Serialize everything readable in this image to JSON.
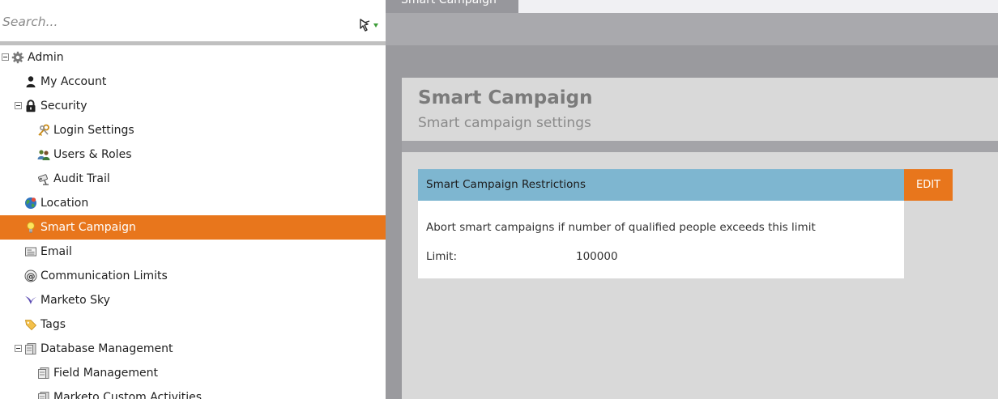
{
  "search": {
    "placeholder": "Search..."
  },
  "tree": [
    {
      "label": "Admin",
      "icon": "gear-icon",
      "expander": true
    },
    {
      "label": "My Account",
      "icon": "person-icon"
    },
    {
      "label": "Security",
      "icon": "lock-icon",
      "expander": true
    },
    {
      "label": "Login Settings",
      "icon": "keys-icon"
    },
    {
      "label": "Users & Roles",
      "icon": "users-icon"
    },
    {
      "label": "Audit Trail",
      "icon": "camera-icon"
    },
    {
      "label": "Location",
      "icon": "globe-icon"
    },
    {
      "label": "Smart Campaign",
      "icon": "lightbulb-icon",
      "selected": true
    },
    {
      "label": "Email",
      "icon": "email-icon"
    },
    {
      "label": "Communication Limits",
      "icon": "at-sign-icon"
    },
    {
      "label": "Marketo Sky",
      "icon": "bird-icon"
    },
    {
      "label": "Tags",
      "icon": "tag-icon"
    },
    {
      "label": "Database Management",
      "icon": "database-icon",
      "expander": true
    },
    {
      "label": "Field Management",
      "icon": "database-icon"
    },
    {
      "label": "Marketo Custom Activities",
      "icon": "database-icon"
    }
  ],
  "tab": {
    "label": "Smart Campaign"
  },
  "header": {
    "title": "Smart Campaign",
    "subtitle": "Smart campaign settings"
  },
  "card": {
    "title": "Smart Campaign Restrictions",
    "edit_label": "EDIT",
    "description": "Abort smart campaigns if number of qualified people exceeds this limit",
    "limit_label": "Limit:",
    "limit_value": "100000"
  },
  "colors": {
    "accent": "#e8761c",
    "card_header": "#7eb6d0"
  }
}
